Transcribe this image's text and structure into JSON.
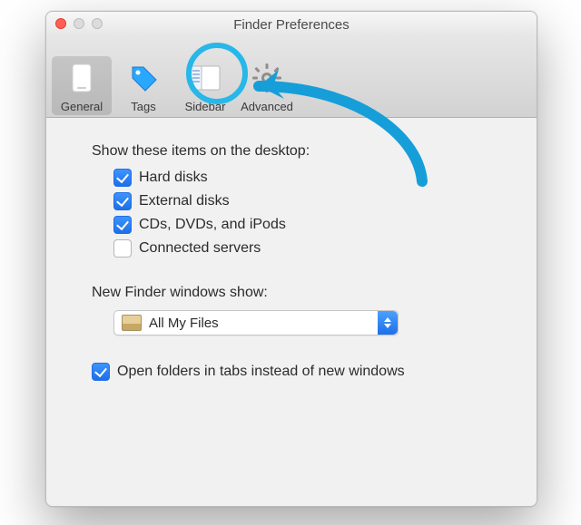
{
  "window": {
    "title": "Finder Preferences"
  },
  "toolbar": {
    "items": [
      {
        "label": "General",
        "icon": "general-icon",
        "selected": true
      },
      {
        "label": "Tags",
        "icon": "tags-icon",
        "selected": false
      },
      {
        "label": "Sidebar",
        "icon": "sidebar-icon",
        "selected": false
      },
      {
        "label": "Advanced",
        "icon": "advanced-icon",
        "selected": false
      }
    ]
  },
  "main": {
    "desktop_section_label": "Show these items on the desktop:",
    "desktop_items": [
      {
        "label": "Hard disks",
        "checked": true
      },
      {
        "label": "External disks",
        "checked": true
      },
      {
        "label": "CDs, DVDs, and iPods",
        "checked": true
      },
      {
        "label": "Connected servers",
        "checked": false
      }
    ],
    "new_windows_label": "New Finder windows show:",
    "new_windows_value": "All My Files",
    "open_in_tabs": {
      "label": "Open folders in tabs instead of new windows",
      "checked": true
    }
  },
  "annotation": {
    "highlight": "sidebar-tab",
    "color": "#27b7e8"
  }
}
